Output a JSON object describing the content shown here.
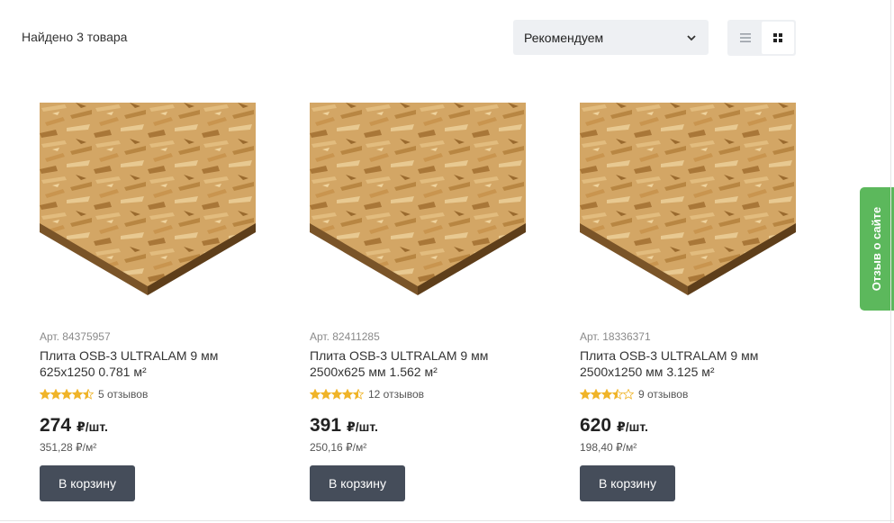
{
  "results": {
    "found_text": "Найдено 3 товара"
  },
  "sort": {
    "selected": "Рекомендуем",
    "icon": "chevron-down-icon"
  },
  "view": {
    "list_icon": "list-view-icon",
    "grid_icon": "grid-view-icon",
    "active": "grid"
  },
  "products": [
    {
      "sku": "Арт. 84375957",
      "title": "Плита OSB-3 ULTRALAM 9 мм 625x1250 0.781 м²",
      "rating": 4.5,
      "reviews": "5 отзывов",
      "price": "274",
      "price_unit": "₽/шт.",
      "price_per_m2": "351,28 ₽/м²",
      "button": "В корзину"
    },
    {
      "sku": "Арт. 82411285",
      "title": "Плита OSB-3 ULTRALAM 9 мм 2500x625 мм 1.562 м²",
      "rating": 4.5,
      "reviews": "12 отзывов",
      "price": "391",
      "price_unit": "₽/шт.",
      "price_per_m2": "250,16 ₽/м²",
      "button": "В корзину"
    },
    {
      "sku": "Арт. 18336371",
      "title": "Плита OSB-3 ULTRALAM 9 мм 2500x1250 мм 3.125 м²",
      "rating": 3.5,
      "reviews": "9 отзывов",
      "price": "620",
      "price_unit": "₽/шт.",
      "price_per_m2": "198,40 ₽/м²",
      "button": "В корзину"
    }
  ],
  "feedback_tab": {
    "label": "Отзыв о сайте"
  },
  "colors": {
    "button": "#454d5a",
    "feedback": "#5cb85c",
    "star": "#f0b429",
    "toolbar_bg": "#eef0f3"
  }
}
